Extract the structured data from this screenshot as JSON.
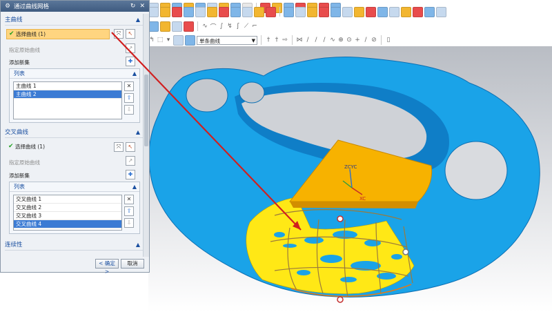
{
  "dialog": {
    "title": "通过曲线网格",
    "primary": {
      "header": "主曲线",
      "select_curve": "选择曲线 (1)",
      "specify_origin": "指定原始曲线",
      "add_new_set": "添加新集",
      "list_header": "列表",
      "items": [
        "主曲线 1",
        "主曲线 2"
      ],
      "selected_index": 1
    },
    "cross": {
      "header": "交叉曲线",
      "select_curve": "选择曲线 (1)",
      "specify_origin": "指定原始曲线",
      "add_new_set": "添加新集",
      "list_header": "列表",
      "items": [
        "交叉曲线 1",
        "交叉曲线 2",
        "交叉曲线 3",
        "交叉曲线 4"
      ],
      "selected_index": 3
    },
    "continuity": {
      "header": "连续性"
    },
    "ok_label": "< 确定 >",
    "cancel_label": "取消"
  },
  "toolbar": {
    "curve_filter": "单条曲线"
  },
  "viewport": {
    "axis_label_zc_yc": "ZCYC",
    "axis_label_xc": "XC"
  },
  "colors": {
    "model_blue": "#1aa3e8",
    "highlight_yellow": "#ffe816",
    "wcs_plane_orange": "#f7b200",
    "arrow_red": "#d11f1f",
    "selection_orange": "#ffd580",
    "dialog_title_blue": "#3f5b80"
  },
  "icons": [
    "gear-icon",
    "refresh-icon",
    "close-icon",
    "check-icon",
    "chevron-up-icon",
    "select-curve-icon",
    "delete-icon",
    "move-up-icon",
    "move-down-icon",
    "add-set-icon",
    "axes-triad-icon"
  ]
}
